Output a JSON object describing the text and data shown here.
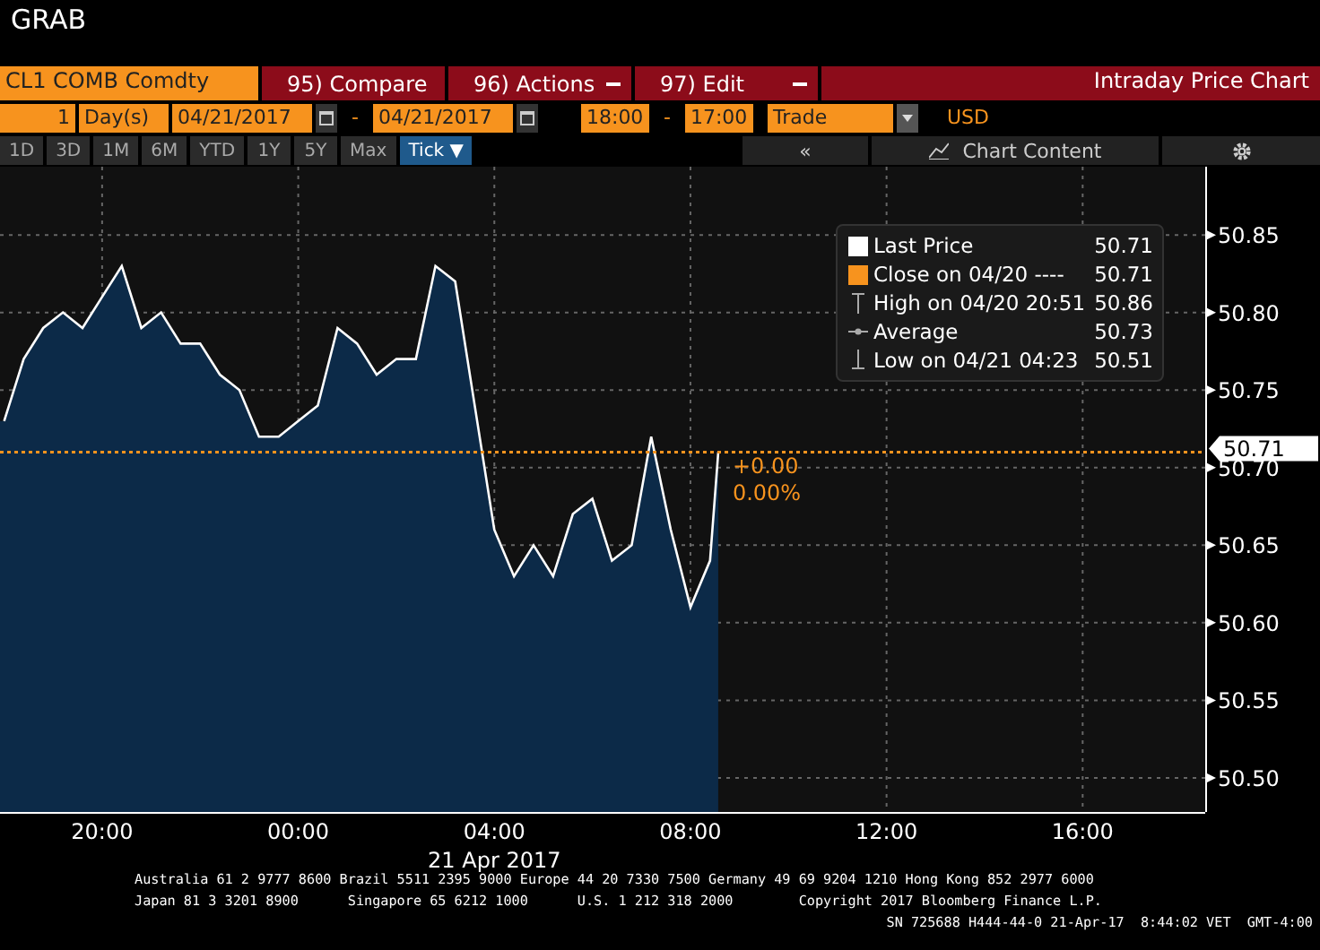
{
  "window": {
    "title": "GRAB"
  },
  "toolbar": {
    "security": "CL1 COMB Comdty",
    "buttons": [
      {
        "label": "95) Compare",
        "dropdown": false
      },
      {
        "label": "96) Actions",
        "dropdown": true
      },
      {
        "label": "97) Edit",
        "dropdown": true
      }
    ],
    "title": "Intraday Price Chart"
  },
  "range_bar": {
    "count": "1",
    "unit": "Day(s)",
    "start_date": "04/21/2017",
    "date_separator": "-",
    "end_date": "04/21/2017",
    "start_time": "18:00",
    "time_separator": "-",
    "end_time": "17:00",
    "mode": "Trade",
    "currency": "USD"
  },
  "periods": [
    {
      "label": "1D",
      "selected": false
    },
    {
      "label": "3D",
      "selected": false
    },
    {
      "label": "1M",
      "selected": false
    },
    {
      "label": "6M",
      "selected": false
    },
    {
      "label": "YTD",
      "selected": false
    },
    {
      "label": "1Y",
      "selected": false
    },
    {
      "label": "5Y",
      "selected": false
    },
    {
      "label": "Max",
      "selected": false
    },
    {
      "label": "Tick ▼",
      "selected": true
    }
  ],
  "chart_tools": {
    "collapse": "«",
    "content": "Chart Content"
  },
  "legend": [
    {
      "kind": "square",
      "color": "#ffffff",
      "value": "50.71"
    },
    {
      "kind": "square",
      "color": "#f7931e",
      "label": "Close on 04/20 ----",
      "value": "50.71"
    },
    {
      "kind": "high",
      "label": "High on 04/20 20:51",
      "value": "50.86"
    },
    {
      "kind": "average",
      "label": "Average",
      "value": "50.73"
    },
    {
      "kind": "low",
      "label": "Low on 04/21 04:23",
      "value": "50.51"
    }
  ],
  "price_tag": {
    "label": "50.71"
  },
  "chart_data": {
    "type": "area",
    "xlabel": "21 Apr 2017",
    "grid": true,
    "xlim": [
      "2017-04-20T17:55",
      "2017-04-21T18:30"
    ],
    "ylim": [
      50.478,
      50.894
    ],
    "xticks": [
      {
        "value": "2017-04-20T20:00",
        "label": "20:00"
      },
      {
        "value": "2017-04-21T00:00",
        "label": "00:00"
      },
      {
        "value": "2017-04-21T04:00",
        "label": "04:00"
      },
      {
        "value": "2017-04-21T08:00",
        "label": "08:00"
      },
      {
        "value": "2017-04-21T12:00",
        "label": "12:00"
      },
      {
        "value": "2017-04-21T16:00",
        "label": "16:00"
      }
    ],
    "yticks": [
      {
        "value": 50.5,
        "label": "50.50"
      },
      50.55,
      {
        "value": 50.6,
        "label": "50.60"
      },
      50.65,
      {
        "value": 50.7,
        "label": "50.70"
      },
      50.75,
      {
        "value": 50.8,
        "label": "50.80"
      },
      50.85
    ],
    "x": [
      "2017-04-20T18:00",
      "2017-04-20T18:24",
      "2017-04-20T18:48",
      "2017-04-20T19:12",
      "2017-04-20T19:36",
      "2017-04-20T20:00",
      "2017-04-20T20:24",
      "2017-04-20T20:48",
      "2017-04-20T21:12",
      "2017-04-20T21:36",
      "2017-04-20T22:00",
      "2017-04-20T22:24",
      "2017-04-20T22:48",
      "2017-04-20T23:12",
      "2017-04-20T23:36",
      "2017-04-21T00:00",
      "2017-04-21T00:24",
      "2017-04-21T00:48",
      "2017-04-21T01:12",
      "2017-04-21T01:36",
      "2017-04-21T02:00",
      "2017-04-21T02:24",
      "2017-04-21T02:48",
      "2017-04-21T03:12",
      "2017-04-21T03:36",
      "2017-04-21T04:00",
      "2017-04-21T04:24",
      "2017-04-21T04:48",
      "2017-04-21T05:12",
      "2017-04-21T05:36",
      "2017-04-21T06:00",
      "2017-04-21T06:24",
      "2017-04-21T06:48",
      "2017-04-21T07:12",
      "2017-04-21T07:36",
      "2017-04-21T08:00",
      "2017-04-21T08:24",
      "2017-04-21T08:34"
    ],
    "series": [
      {
        "name": "Last Price",
        "color": "#ffffff",
        "values": [
          50.73,
          50.77,
          50.79,
          50.8,
          50.79,
          50.81,
          50.83,
          50.79,
          50.8,
          50.78,
          50.78,
          50.76,
          50.75,
          50.72,
          50.72,
          50.73,
          50.74,
          50.79,
          50.78,
          50.76,
          50.77,
          50.77,
          50.83,
          50.82,
          50.74,
          50.66,
          50.63,
          50.65,
          50.63,
          50.67,
          50.68,
          50.64,
          50.65,
          50.72,
          50.66,
          50.61,
          50.64,
          50.71
        ]
      }
    ],
    "ref_lines": [
      {
        "axis": "y",
        "value": 50.71,
        "color": "#f7931e"
      }
    ],
    "annotations": [
      "+0.00",
      "0.00%"
    ]
  },
  "footer": {
    "contacts": [
      "Australia 61 2 9777 8600 Brazil 5511 2395 9000 Europe 44 20 7330 7500 Germany 49 69 9204 1210 Hong Kong 852 2977 6000",
      "Japan 81 3 3201 8900      Singapore 65 6212 1000      U.S. 1 212 318 2000        Copyright 2017 Bloomberg Finance L.P."
    ],
    "session": "SN 725688 H444-44-0 21-Apr-17  8:44:02 VET  GMT-4:00"
  }
}
